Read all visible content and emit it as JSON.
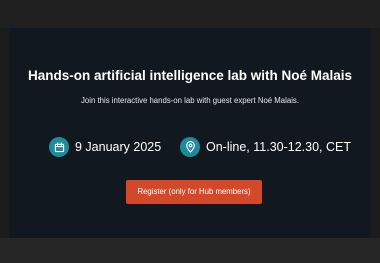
{
  "event": {
    "title": "Hands-on artificial intelligence lab with Noé Malais",
    "subtitle": "Join this interactive hands-on lab with guest expert Noé Malais.",
    "date": {
      "icon": "calendar-icon",
      "text": "9 January 2025"
    },
    "location": {
      "icon": "location-pin-icon",
      "text": "On-line, 11.30-12.30, CET"
    },
    "register_label": "Register (only for Hub members)"
  },
  "colors": {
    "page_background": "#1b1b1b",
    "panel_background": "#121820",
    "icon_accent": "#1f8a9a",
    "button_accent": "#d4482a",
    "text": "#ffffff"
  }
}
